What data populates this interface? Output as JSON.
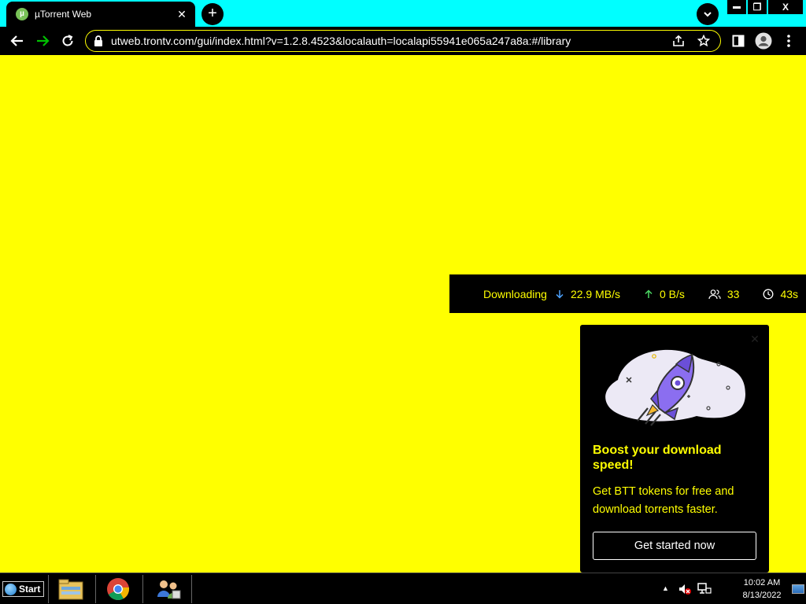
{
  "browser": {
    "tab": {
      "title": "µTorrent Web",
      "favicon": "utorrent-logo-icon",
      "close_glyph": "✕"
    },
    "new_tab_glyph": "+",
    "url": "utweb.trontv.com/gui/index.html?v=1.2.8.4523&localauth=localapi55941e065a247a8a:#/library",
    "window_controls": {
      "minimize": "▬",
      "restore": "❐",
      "close": "X"
    },
    "accent_colors": {
      "tabstrip": "#00ffff",
      "omnibox_border": "#ffff00",
      "forward_arrow": "#00c000"
    }
  },
  "page": {
    "background": "#ffff00",
    "status": {
      "label": "Downloading",
      "download_speed": "22.9 MB/s",
      "upload_speed": "0 B/s",
      "peers": "33",
      "eta": "43s"
    },
    "promo": {
      "heading": "Boost your download speed!",
      "body": "Get BTT tokens for free and download torrents faster.",
      "cta": "Get started now",
      "art": "rocket-illustration"
    }
  },
  "taskbar": {
    "start_label": "Start",
    "apps": [
      "file-explorer-icon",
      "chrome-icon",
      "network-users-icon"
    ],
    "tray": [
      "volume-muted-icon",
      "network-icon"
    ],
    "clock_time": "10:02 AM",
    "clock_date": "8/13/2022"
  }
}
